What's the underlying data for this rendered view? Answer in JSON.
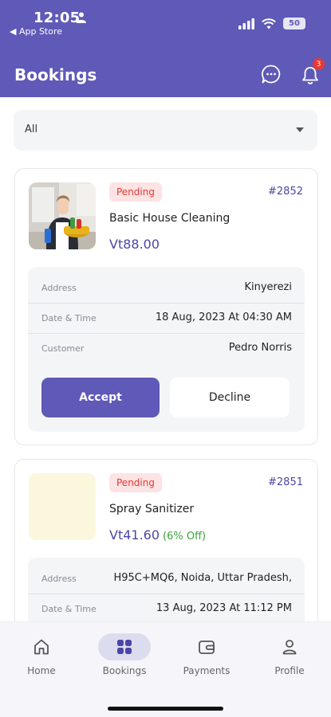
{
  "status_bar": {
    "time": "12:05",
    "back_label": "◀ App Store",
    "battery": "50"
  },
  "header": {
    "title": "Bookings",
    "notification_count": "3"
  },
  "filter": {
    "value": "All"
  },
  "bookings": [
    {
      "status": "Pending",
      "id": "#2852",
      "service": "Basic House Cleaning",
      "price": "Vt88.00",
      "discount": "",
      "address_label": "Address",
      "address": "Kinyerezi",
      "datetime_label": "Date & Time",
      "datetime": "18 Aug, 2023 At 04:30 AM",
      "customer_label": "Customer",
      "customer": "Pedro Norris",
      "accept_label": "Accept",
      "decline_label": "Decline"
    },
    {
      "status": "Pending",
      "id": "#2851",
      "service": "Spray Sanitizer",
      "price": "Vt41.60",
      "discount": "(6% Off)",
      "address_label": "Address",
      "address": "H95C+MQ6, Noida, Uttar Pradesh,",
      "datetime_label": "Date & Time",
      "datetime": "13 Aug, 2023 At 11:12 PM"
    }
  ],
  "nav": {
    "items": [
      {
        "label": "Home",
        "icon": "home-icon"
      },
      {
        "label": "Bookings",
        "icon": "bookings-icon",
        "active": true
      },
      {
        "label": "Payments",
        "icon": "wallet-icon"
      },
      {
        "label": "Profile",
        "icon": "person-icon"
      }
    ]
  },
  "colors": {
    "primary": "#5f59b7",
    "pending_text": "#e53935",
    "pending_bg": "#fde3e3",
    "discount": "#3aa43a"
  }
}
